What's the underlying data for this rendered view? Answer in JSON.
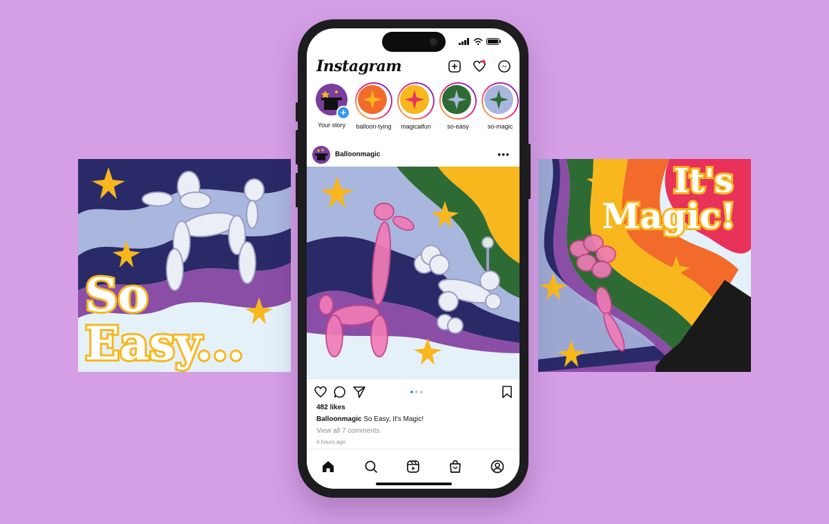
{
  "left_panel": {
    "text_line1": "So",
    "text_line2": "Easy..."
  },
  "right_panel": {
    "text_line1": "It's",
    "text_line2": "Magic!"
  },
  "app": {
    "name": "Instagram"
  },
  "stories": [
    {
      "label": "Your story",
      "color": "#7a3f9e"
    },
    {
      "label": "balloon-tying",
      "color": "#f26b2b"
    },
    {
      "label": "magicalfun",
      "color": "#f7b71d"
    },
    {
      "label": "so-easy",
      "color": "#2e6b34"
    },
    {
      "label": "so-magic",
      "color": "#a9b6de"
    }
  ],
  "post": {
    "username": "Balloonmagic",
    "likes": "482 likes",
    "caption_user": "Balloonmagic",
    "caption_text": "So Easy, It's Magic!",
    "comments": "View all 7 comments",
    "time": "4 hours ago",
    "carousel": {
      "total": 3,
      "active": 1
    }
  },
  "colors": {
    "accent": "#3897f0",
    "background": "#d59fe6",
    "star": "#f7b71d"
  }
}
